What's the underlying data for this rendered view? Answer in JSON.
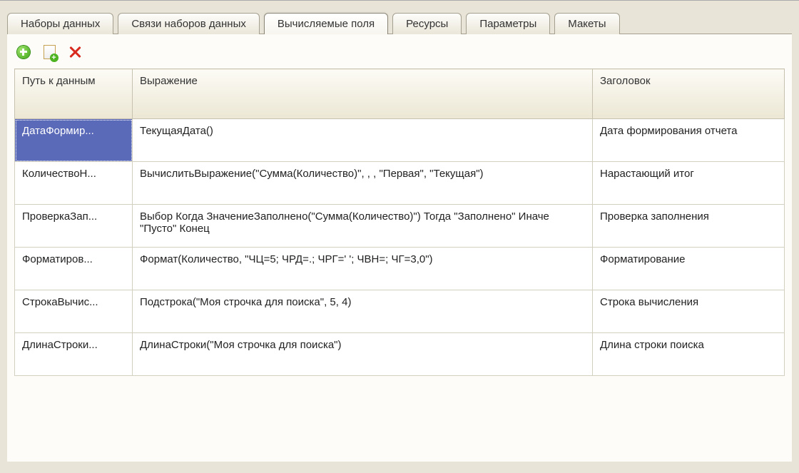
{
  "tabs": [
    {
      "label": "Наборы данных"
    },
    {
      "label": "Связи наборов данных"
    },
    {
      "label": "Вычисляемые поля"
    },
    {
      "label": "Ресурсы"
    },
    {
      "label": "Параметры"
    },
    {
      "label": "Макеты"
    }
  ],
  "active_tab_index": 2,
  "columns": {
    "path": "Путь к данным",
    "expr": "Выражение",
    "title": "Заголовок"
  },
  "rows": [
    {
      "path": "ДатаФормир...",
      "expr": "ТекущаяДата()",
      "title": "Дата формирования отчета"
    },
    {
      "path": "КоличествоН...",
      "expr": "ВычислитьВыражение(\"Сумма(Количество)\", , , \"Первая\", \"Текущая\")",
      "title": "Нарастающий итог"
    },
    {
      "path": "ПроверкаЗап...",
      "expr": "Выбор Когда ЗначениеЗаполнено(\"Сумма(Количество)\") Тогда \"Заполнено\" Иначе \"Пусто\" Конец",
      "title": "Проверка заполнения"
    },
    {
      "path": "Форматиров...",
      "expr": "Формат(Количество, \"ЧЦ=5; ЧРД=.; ЧРГ=' '; ЧВН=; ЧГ=3,0\")",
      "title": "Форматирование"
    },
    {
      "path": "СтрокаВычис...",
      "expr": "Подстрока(\"Моя строчка для поиска\", 5, 4)",
      "title": "Строка вычисления"
    },
    {
      "path": "ДлинаСтроки...",
      "expr": "ДлинаСтроки(\"Моя строчка для поиска\")",
      "title": "Длина строки поиска"
    }
  ],
  "selected_row_index": 0
}
